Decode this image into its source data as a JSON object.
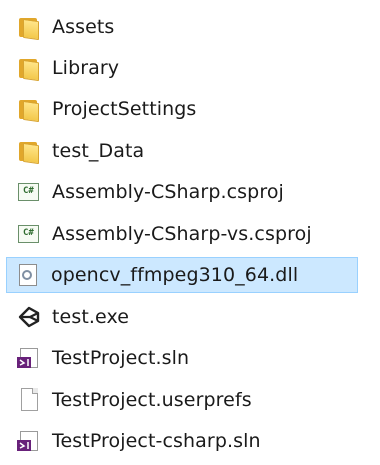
{
  "files": [
    {
      "name": "Assets",
      "icon": "folder-icon"
    },
    {
      "name": "Library",
      "icon": "folder-icon"
    },
    {
      "name": "ProjectSettings",
      "icon": "folder-icon"
    },
    {
      "name": "test_Data",
      "icon": "folder-icon"
    },
    {
      "name": "Assembly-CSharp.csproj",
      "icon": "csproj-icon"
    },
    {
      "name": "Assembly-CSharp-vs.csproj",
      "icon": "csproj-icon"
    },
    {
      "name": "opencv_ffmpeg310_64.dll",
      "icon": "dll-icon",
      "selected": true
    },
    {
      "name": "test.exe",
      "icon": "unity-icon"
    },
    {
      "name": "TestProject.sln",
      "icon": "visual-studio-solution-icon"
    },
    {
      "name": "TestProject.userprefs",
      "icon": "document-icon"
    },
    {
      "name": "TestProject-csharp.sln",
      "icon": "visual-studio-solution-icon"
    }
  ],
  "colors": {
    "selection_bg": "#cce8ff",
    "selection_border": "#99d1ff",
    "folder": "#f3c84a"
  }
}
